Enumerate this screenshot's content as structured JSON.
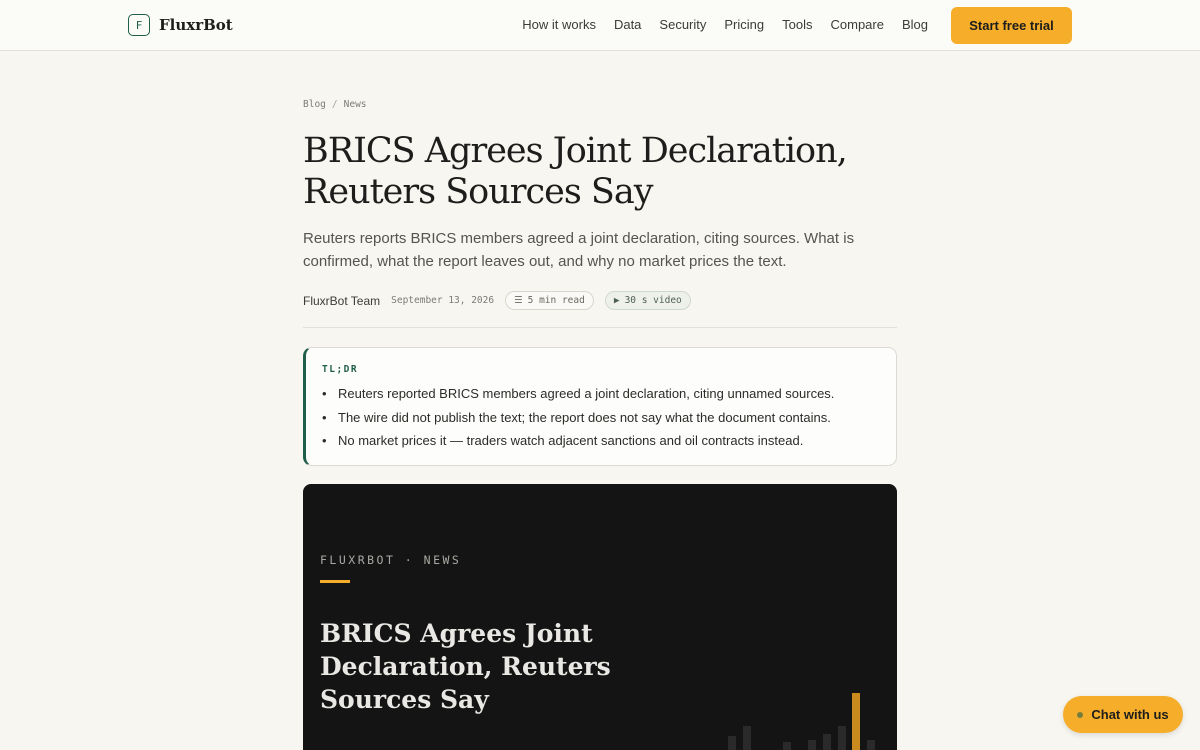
{
  "header": {
    "brand_mark": "F",
    "brand_name": "FluxrBot",
    "nav": [
      "How it works",
      "Data",
      "Security",
      "Pricing",
      "Tools",
      "Compare",
      "Blog"
    ],
    "cta_label": "Start free trial"
  },
  "breadcrumb": {
    "items": [
      "Blog",
      "News"
    ],
    "separator": "/"
  },
  "article": {
    "title": "BRICS Agrees Joint Declaration, Reuters Sources Say",
    "dek": "Reuters reports BRICS members agreed a joint declaration, citing sources. What is confirmed, what the report leaves out, and why no market prices the text.",
    "author": "FluxrBot Team",
    "date": "September 13, 2026",
    "read_time": "5 min read",
    "video": "30 s video",
    "icons": {
      "read_time": "list-icon",
      "video": "play-icon"
    }
  },
  "tldr": {
    "label": "TL;DR",
    "items": [
      "Reuters reported BRICS members agreed a joint declaration, citing unnamed sources.",
      "The wire did not publish the text; the report does not say what the document contains.",
      "No market prices it — traders watch adjacent sanctions and oil contracts instead."
    ]
  },
  "hero": {
    "kicker": "FLUXRBOT · NEWS",
    "title": "BRICS Agrees Joint Declaration, Reuters Sources Say"
  },
  "chat": {
    "label": "Chat with us"
  },
  "colors": {
    "accent": "#f5ad2a",
    "brand": "#1f5e4b",
    "hero_bg": "#141414"
  }
}
